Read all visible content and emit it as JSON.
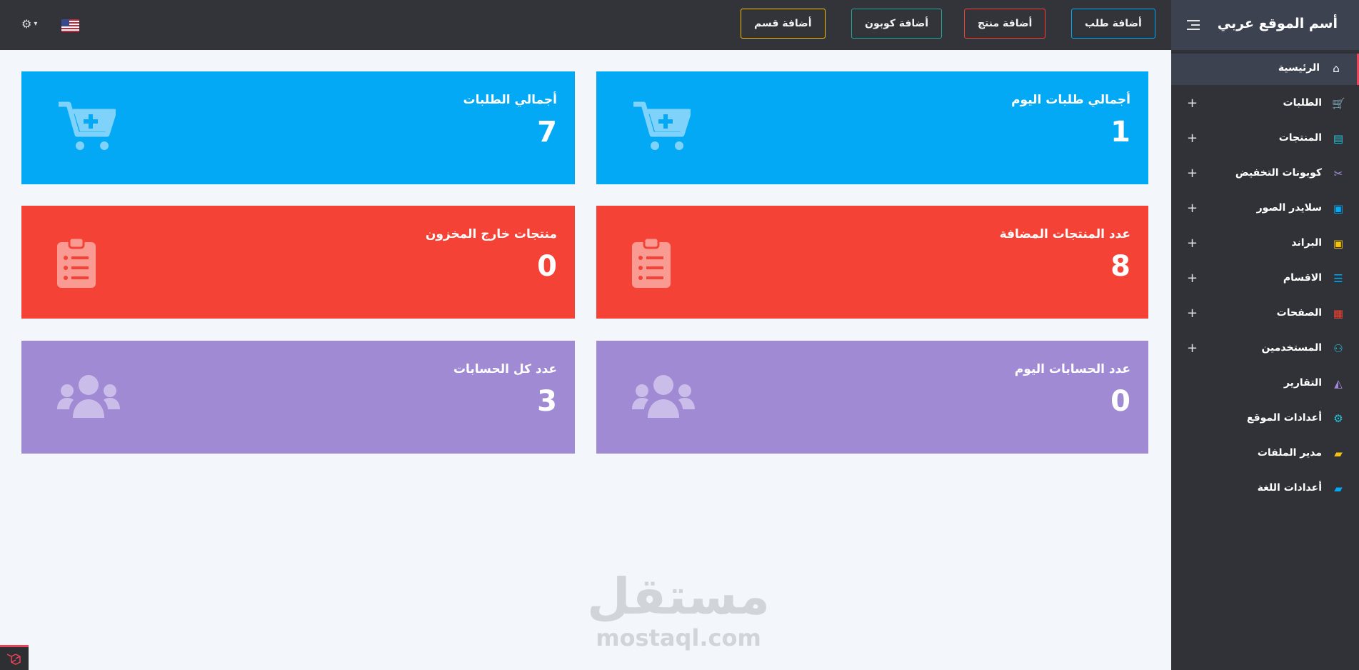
{
  "site_title": "أسم الموقع عربي",
  "topbar": {
    "buttons": [
      {
        "label": "أضافة طلب",
        "color": "#03a9f4"
      },
      {
        "label": "أضافة منتج",
        "color": "#f44336"
      },
      {
        "label": "أضافة كوبون",
        "color": "#26a69a"
      },
      {
        "label": "أضافة قسم",
        "color": "#f4c20d"
      }
    ],
    "settings_icon": "gear-icon",
    "language_flag": "us-flag-icon"
  },
  "sidebar": {
    "items": [
      {
        "label": "الرئيسية",
        "icon": "home-icon",
        "glyph": "⌂",
        "color": "#ffffff",
        "expandable": false,
        "active": true
      },
      {
        "label": "الطلبات",
        "icon": "cart-icon",
        "glyph": "🛒",
        "color": "#f44336",
        "expandable": true
      },
      {
        "label": "المنتجات",
        "icon": "clipboard-icon",
        "glyph": "▤",
        "color": "#26c6da",
        "expandable": true
      },
      {
        "label": "كوبونات التخفيض",
        "icon": "scissors-icon",
        "glyph": "✂",
        "color": "#a18ad4",
        "expandable": true
      },
      {
        "label": "سلايدر الصور",
        "icon": "image-icon",
        "glyph": "▣",
        "color": "#03a9f4",
        "expandable": true
      },
      {
        "label": "البراند",
        "icon": "images-icon",
        "glyph": "▣",
        "color": "#f4c20d",
        "expandable": true
      },
      {
        "label": "الاقسام",
        "icon": "list-icon",
        "glyph": "☰",
        "color": "#03a9f4",
        "expandable": true
      },
      {
        "label": "الصفحات",
        "icon": "newspaper-icon",
        "glyph": "▦",
        "color": "#f44336",
        "expandable": true
      },
      {
        "label": "المستخدمين",
        "icon": "users-cog-icon",
        "glyph": "⚇",
        "color": "#26c6da",
        "expandable": true
      },
      {
        "label": "التقارير",
        "icon": "chart-area-icon",
        "glyph": "◭",
        "color": "#a18ad4",
        "expandable": false
      },
      {
        "label": "أعدادات الموقع",
        "icon": "gear-icon",
        "glyph": "⚙",
        "color": "#26c6da",
        "expandable": false
      },
      {
        "label": "مدير الملفات",
        "icon": "folder-open-icon",
        "glyph": "▰",
        "color": "#f4c20d",
        "expandable": false
      },
      {
        "label": "أعدادات اللغة",
        "icon": "folder-open-icon",
        "glyph": "▰",
        "color": "#03a9f4",
        "expandable": false
      }
    ],
    "plus_symbol": "+"
  },
  "cards": [
    {
      "title": "أجمالي طلبات اليوم",
      "value": "1",
      "icon": "cart-plus-icon",
      "color": "#03a9f4"
    },
    {
      "title": "أجمالي الطلبات",
      "value": "7",
      "icon": "cart-plus-icon",
      "color": "#03a9f4"
    },
    {
      "title": "عدد المنتجات المضافة",
      "value": "8",
      "icon": "clipboard-list-icon",
      "color": "#f44336"
    },
    {
      "title": "منتجات خارج المخزون",
      "value": "0",
      "icon": "clipboard-list-icon",
      "color": "#f44336"
    },
    {
      "title": "عدد الحسابات اليوم",
      "value": "0",
      "icon": "users-icon",
      "color": "#a18ad4"
    },
    {
      "title": "عدد كل الحسابات",
      "value": "3",
      "icon": "users-icon",
      "color": "#a18ad4"
    }
  ],
  "watermark": {
    "arabic": "مستقل",
    "latin": "mostaql.com"
  }
}
